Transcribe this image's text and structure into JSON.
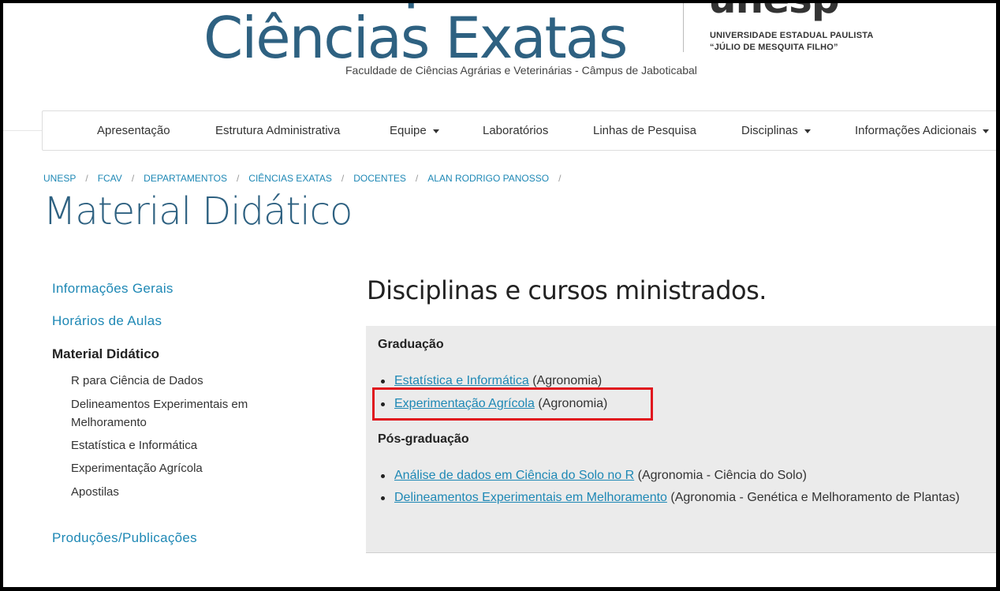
{
  "header": {
    "dept_top": "Departamento de",
    "dept_name": "Ciências Exatas",
    "unesp_logo": "unesp",
    "unesp_line1": "UNIVERSIDADE ESTADUAL PAULISTA",
    "unesp_line2": "“JÚLIO DE MESQUITA FILHO”",
    "faculty": "Faculdade de Ciências Agrárias e Veterinárias - Câmpus de Jaboticabal"
  },
  "nav": {
    "items": [
      {
        "label": "Apresentação"
      },
      {
        "label": "Estrutura Administrativa"
      },
      {
        "label": "Equipe"
      },
      {
        "label": "Laboratórios"
      },
      {
        "label": "Linhas de Pesquisa"
      },
      {
        "label": "Disciplinas"
      },
      {
        "label": "Informações Adicionais"
      }
    ]
  },
  "breadcrumb": [
    "UNESP",
    "FCAV",
    "DEPARTAMENTOS",
    "CIÊNCIAS EXATAS",
    "DOCENTES",
    "ALAN RODRIGO PANOSSO"
  ],
  "page_title": "Material Didático",
  "sidebar": {
    "links": [
      "Informações Gerais",
      "Horários de Aulas"
    ],
    "active": "Material Didático",
    "sub_items": [
      "R para Ciência de Dados",
      "Delineamentos Experimentais em Melhoramento",
      "Estatística e Informática",
      "Experimentação Agrícola",
      "Apostilas"
    ],
    "bottom_link": "Produções/Publicações"
  },
  "main": {
    "heading": "Disciplinas e cursos ministrados.",
    "graduacao": {
      "title": "Graduação",
      "items": [
        {
          "link": "Estatística e Informática",
          "note": "(Agronomia)"
        },
        {
          "link": "Experimentação Agrícola",
          "note": "(Agronomia)"
        }
      ]
    },
    "pos": {
      "title": "Pós-graduação",
      "items": [
        {
          "link": "Análise de dados em Ciência do Solo no R",
          "note": "(Agronomia - Ciência do Solo)"
        },
        {
          "link": "Delineamentos Experimentais em Melhoramento",
          "note": "(Agronomia - Genética e Melhoramento de Plantas)"
        }
      ]
    }
  },
  "colors": {
    "brand_blue": "#2e6181",
    "link_blue": "#1e88b5",
    "highlight_red": "#e0161e"
  }
}
